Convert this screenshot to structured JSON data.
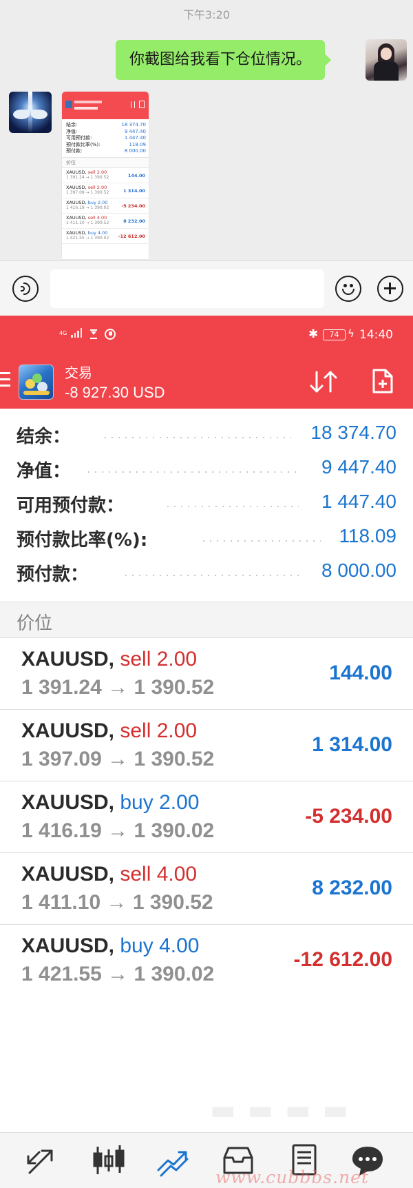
{
  "chat": {
    "timestamp": "下午3:20",
    "sent_message": "你截图给我看下仓位情况。",
    "thumbnail": {
      "summary": [
        {
          "label": "结余:",
          "value": "18 374.70"
        },
        {
          "label": "净值:",
          "value": "9 447.40"
        },
        {
          "label": "可用预付款:",
          "value": "1 447.40"
        },
        {
          "label": "预付款比率(%):",
          "value": "118.09"
        },
        {
          "label": "预付款:",
          "value": "8 000.00"
        }
      ],
      "section": "价位",
      "positions": [
        {
          "symbol": "XAUUSD,",
          "side": "sell",
          "lots": "2.00",
          "prices": "1 391.24 → 1 390.52",
          "profit": "144.00"
        },
        {
          "symbol": "XAUUSD,",
          "side": "sell",
          "lots": "2.00",
          "prices": "1 397.09 → 1 390.52",
          "profit": "1 314.00"
        },
        {
          "symbol": "XAUUSD,",
          "side": "buy",
          "lots": "2.00",
          "prices": "1 416.19 → 1 390.02",
          "profit": "-5 234.00"
        },
        {
          "symbol": "XAUUSD,",
          "side": "sell",
          "lots": "4.00",
          "prices": "1 411.10 → 1 390.52",
          "profit": "8 232.00"
        },
        {
          "symbol": "XAUUSD,",
          "side": "buy",
          "lots": "4.00",
          "prices": "1 421.55 → 1 390.02",
          "profit": "-12 612.00"
        }
      ]
    }
  },
  "input_bar": {
    "voice_icon": "voice-icon",
    "emoji_icon": "emoji-icon",
    "plus_icon": "plus-icon"
  },
  "status_bar": {
    "network": "4G",
    "battery": "74",
    "time": "14:40"
  },
  "app_bar": {
    "title": "交易",
    "balance_change": "-8 927.30 USD"
  },
  "summary": [
    {
      "label": "结余：",
      "value": "18 374.70"
    },
    {
      "label": "净值：",
      "value": "9 447.40"
    },
    {
      "label": "可用预付款：",
      "value": "1 447.40"
    },
    {
      "label": "预付款比率(%):",
      "value": "118.09"
    },
    {
      "label": "预付款：",
      "value": "8 000.00"
    }
  ],
  "section_title": "价位",
  "positions": [
    {
      "symbol": "XAUUSD,",
      "side": "sell",
      "lots": "2.00",
      "open_price": "1 391.24",
      "current_price": "1 390.52",
      "profit": "144.00"
    },
    {
      "symbol": "XAUUSD,",
      "side": "sell",
      "lots": "2.00",
      "open_price": "1 397.09",
      "current_price": "1 390.52",
      "profit": "1 314.00"
    },
    {
      "symbol": "XAUUSD,",
      "side": "buy",
      "lots": "2.00",
      "open_price": "1 416.19",
      "current_price": "1 390.02",
      "profit": "-5 234.00"
    },
    {
      "symbol": "XAUUSD,",
      "side": "sell",
      "lots": "4.00",
      "open_price": "1 411.10",
      "current_price": "1 390.52",
      "profit": "8 232.00"
    },
    {
      "symbol": "XAUUSD,",
      "side": "buy",
      "lots": "4.00",
      "open_price": "1 421.55",
      "current_price": "1 390.02",
      "profit": "-12 612.00"
    }
  ],
  "bottom_nav": [
    {
      "icon": "quotes-icon"
    },
    {
      "icon": "chart-icon"
    },
    {
      "icon": "trade-icon",
      "active": true
    },
    {
      "icon": "history-icon"
    },
    {
      "icon": "news-icon"
    },
    {
      "icon": "chat-icon"
    }
  ],
  "watermark": "www.cubbbs.net",
  "colors": {
    "accent_red": "#f0444a",
    "value_blue": "#1b75d0",
    "loss_red": "#d32f2f",
    "chat_bubble": "#95ec69"
  }
}
